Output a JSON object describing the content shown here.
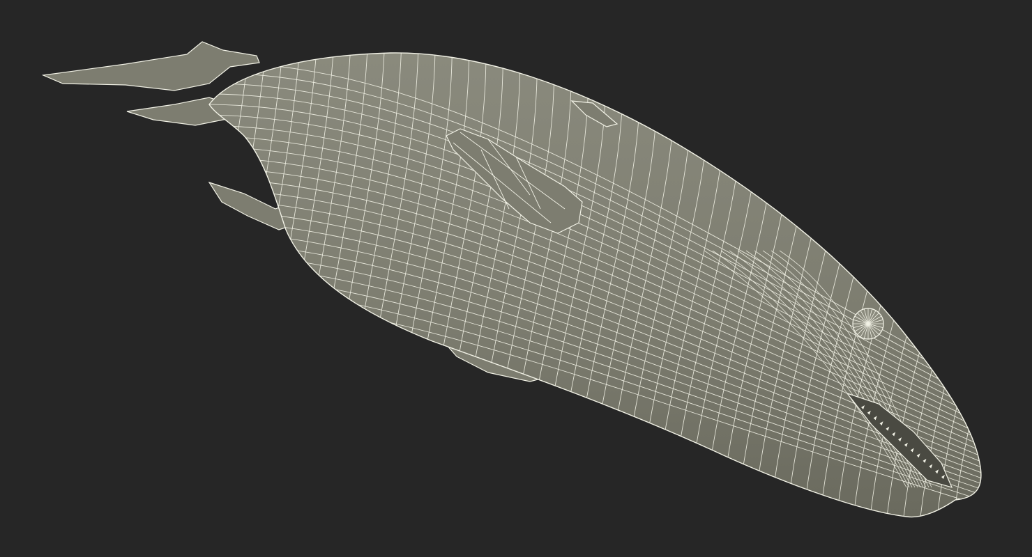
{
  "scene": {
    "subject": "fish-wireframe-model",
    "colors": {
      "background": "#262626",
      "body_fill": "#7d7d70",
      "body_shadow": "#6a6a5e",
      "body_highlight": "#8a8a7d",
      "wire": "#f2f2e6"
    }
  }
}
